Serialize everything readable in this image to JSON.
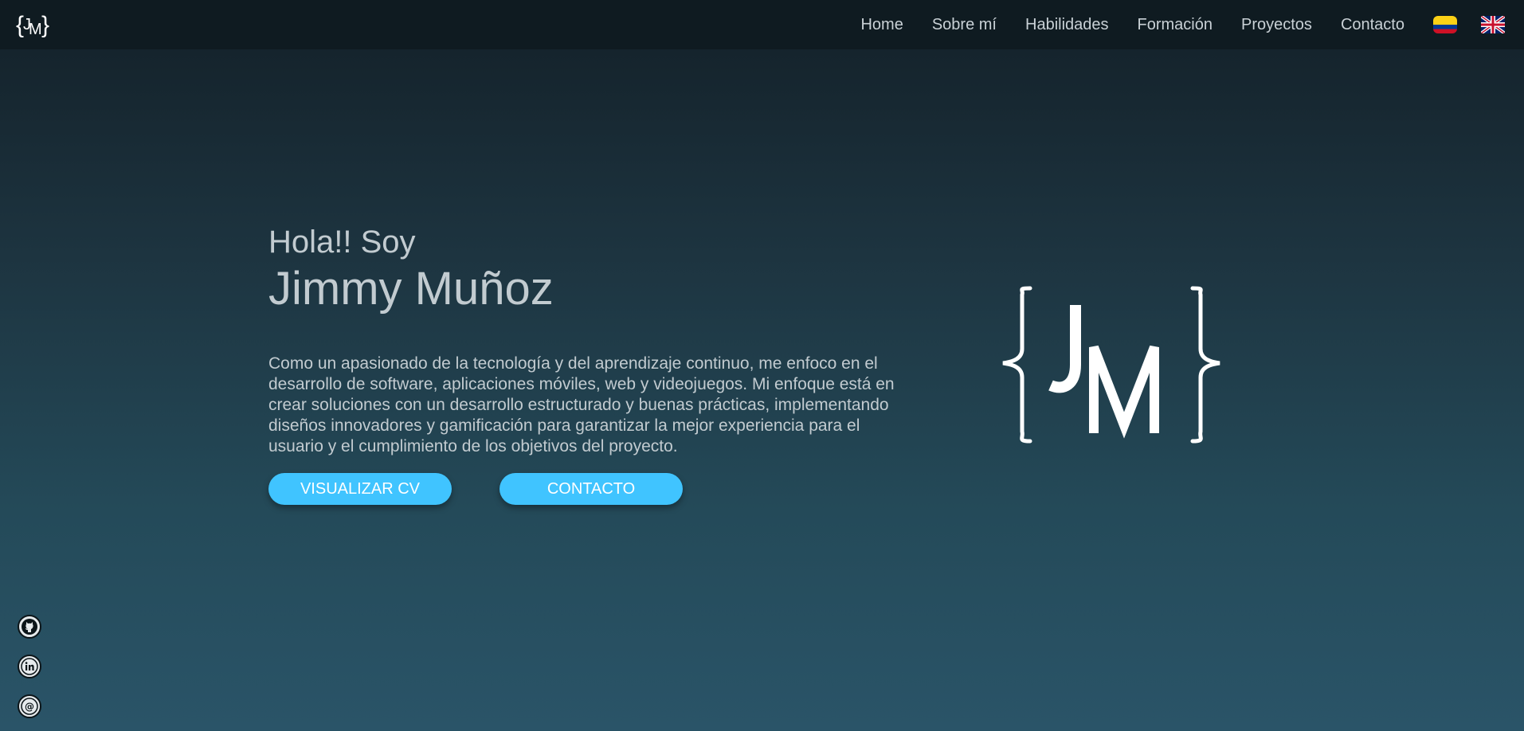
{
  "nav": {
    "logo_icon": "jm-brace-logo-icon",
    "logo_text": "JM",
    "links": [
      {
        "label": "Home"
      },
      {
        "label": "Sobre mí"
      },
      {
        "label": "Habilidades"
      },
      {
        "label": "Formación"
      },
      {
        "label": "Proyectos"
      },
      {
        "label": "Contacto"
      }
    ],
    "languages": [
      {
        "icon": "colombia-flag-icon"
      },
      {
        "icon": "uk-flag-icon"
      }
    ]
  },
  "hero": {
    "greeting": "Hola!! Soy",
    "name": "Jimmy Muñoz",
    "bio": "Como un apasionado de la tecnología y del aprendizaje continuo, me enfoco en el desarrollo de software, aplicaciones móviles, web y videojuegos. Mi enfoque está en crear soluciones con un desarrollo estructurado y buenas prácticas, implementando diseños innovadores y gamificación para garantizar la mejor experiencia para el usuario y el cumplimiento de los objetivos del proyecto.",
    "cv_button": "VISUALIZAR CV",
    "contact_button": "CONTACTO",
    "logo_text": "JM"
  },
  "socials": [
    {
      "icon": "github-icon"
    },
    {
      "icon": "linkedin-icon"
    },
    {
      "icon": "email-at-icon"
    }
  ],
  "colors": {
    "accent": "#40c4ff",
    "navbar": "#0f1b21",
    "text": "#c2cbd0"
  }
}
